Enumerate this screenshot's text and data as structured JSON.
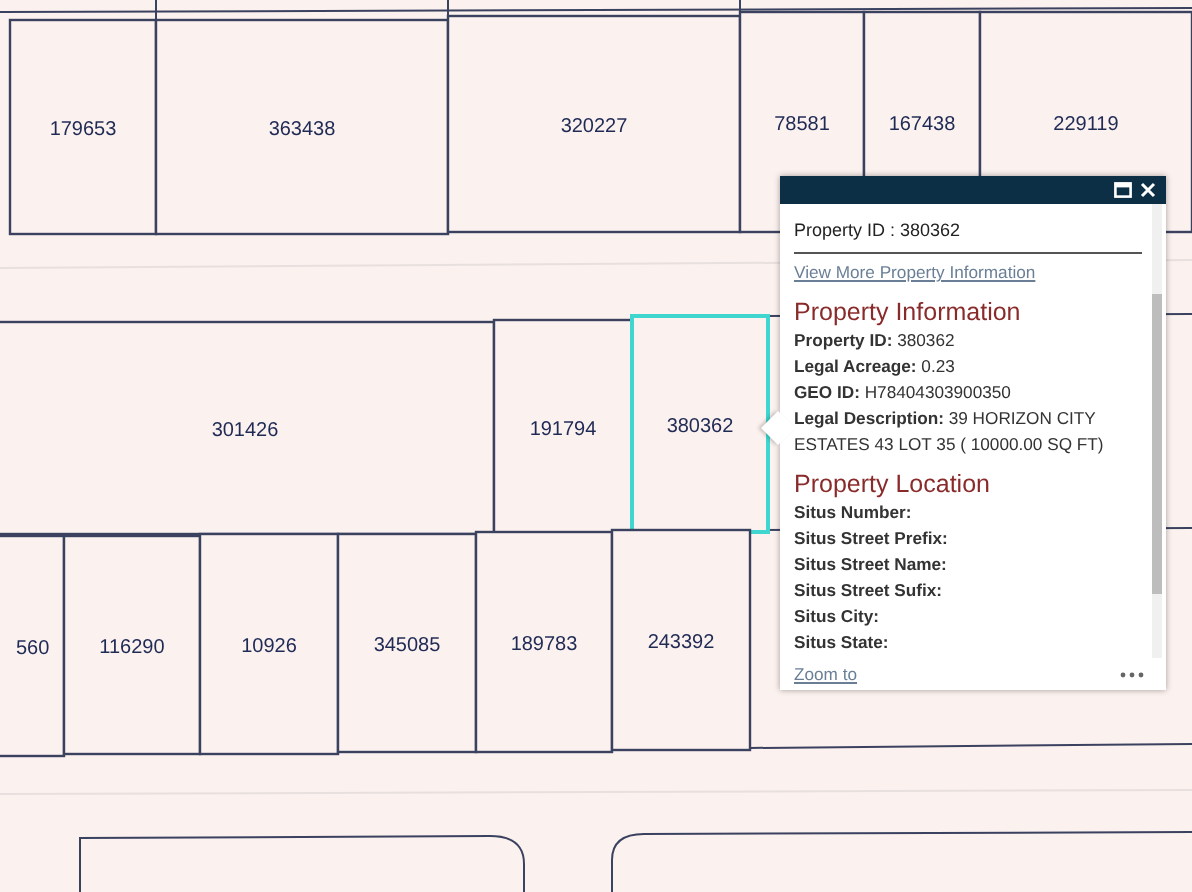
{
  "map": {
    "parcels": [
      {
        "label": "179653",
        "selected": false
      },
      {
        "label": "363438",
        "selected": false
      },
      {
        "label": "320227",
        "selected": false
      },
      {
        "label": "78581",
        "selected": false
      },
      {
        "label": "167438",
        "selected": false
      },
      {
        "label": "229119",
        "selected": false
      },
      {
        "label": "301426",
        "selected": false
      },
      {
        "label": "191794",
        "selected": false
      },
      {
        "label": "380362",
        "selected": true
      },
      {
        "label": "560",
        "selected": false
      },
      {
        "label": "116290",
        "selected": false
      },
      {
        "label": "10926",
        "selected": false
      },
      {
        "label": "345085",
        "selected": false
      },
      {
        "label": "189783",
        "selected": false
      },
      {
        "label": "243392",
        "selected": false
      }
    ]
  },
  "popup": {
    "title": "Property ID : 380362",
    "link": "View More Property Information",
    "sections": [
      {
        "heading": "Property Information",
        "fields": [
          {
            "label": "Property ID:",
            "value": "380362"
          },
          {
            "label": "Legal Acreage:",
            "value": "0.23"
          },
          {
            "label": "GEO ID:",
            "value": "H78404303900350"
          },
          {
            "label": "Legal Description:",
            "value": "39 HORIZON CITY ESTATES 43 LOT 35 ( 10000.00 SQ FT)"
          }
        ]
      },
      {
        "heading": "Property Location",
        "fields": [
          {
            "label": "Situs Number:"
          },
          {
            "label": "Situs Street Prefix:"
          },
          {
            "label": "Situs Street Name:"
          },
          {
            "label": "Situs Street Sufix:"
          },
          {
            "label": "Situs City:"
          },
          {
            "label": "Situs State:"
          }
        ]
      }
    ],
    "zoom_link": "Zoom to"
  }
}
